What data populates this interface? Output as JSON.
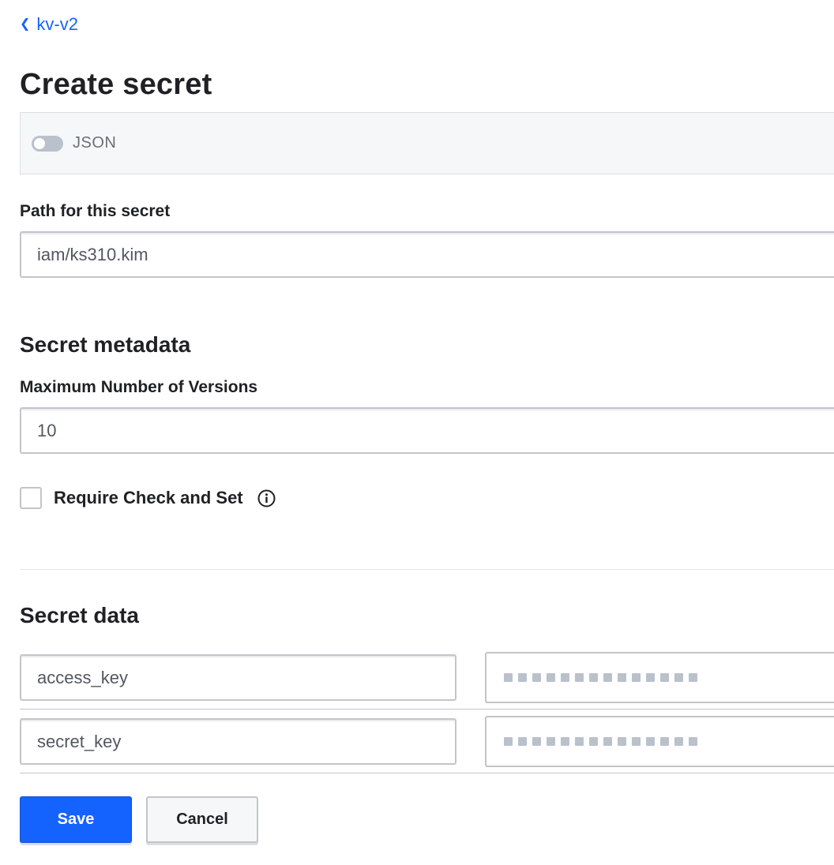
{
  "breadcrumb": {
    "label": "kv-v2"
  },
  "page_title": "Create secret",
  "json_toggle": {
    "label": "JSON",
    "on": false
  },
  "path": {
    "label": "Path for this secret",
    "value": "iam/ks310.kim"
  },
  "metadata": {
    "title": "Secret metadata",
    "max_versions_label": "Maximum Number of Versions",
    "max_versions_value": "10",
    "require_cas_label": "Require Check and Set",
    "require_cas_checked": false
  },
  "secret_data": {
    "title": "Secret data",
    "rows": [
      {
        "key": "access_key",
        "value_masked": true
      },
      {
        "key": "secret_key",
        "value_masked": true
      }
    ]
  },
  "buttons": {
    "save": "Save",
    "cancel": "Cancel"
  },
  "colors": {
    "accent": "#1563ff",
    "text": "#1f2124",
    "border": "#c2c5cb",
    "mask": "#bac1cc"
  },
  "icons": {
    "breadcrumb": "chevron-left-icon",
    "info": "info-circle-icon"
  }
}
